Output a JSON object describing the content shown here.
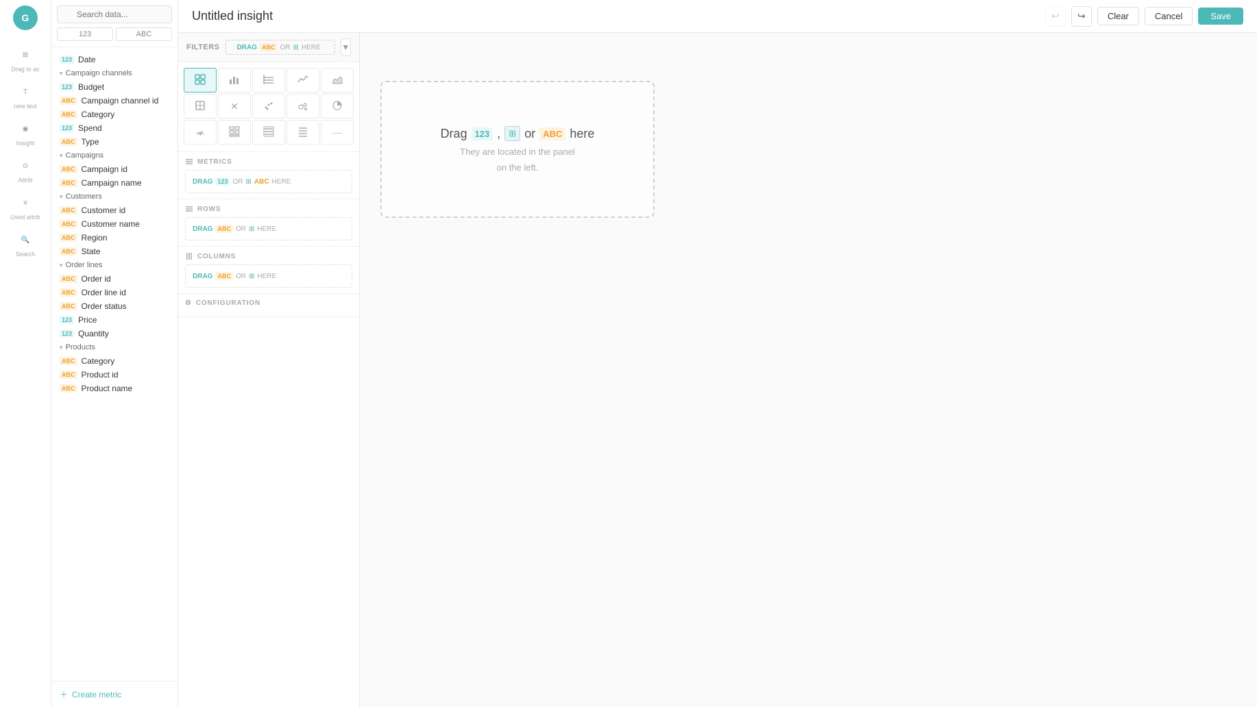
{
  "app": {
    "logo_text": "G",
    "nav_items": [
      {
        "id": "drag",
        "label": "Drag to ac",
        "icon": "⊞"
      },
      {
        "id": "new_text",
        "label": "new text",
        "icon": "T"
      },
      {
        "id": "insight",
        "label": "Insight",
        "icon": "◉"
      },
      {
        "id": "attrib",
        "label": "Attrib",
        "icon": "⊙"
      },
      {
        "id": "used_attrib",
        "label": "Used attrib",
        "icon": "≡"
      },
      {
        "id": "search",
        "label": "Search",
        "icon": "🔍"
      }
    ]
  },
  "data_panel": {
    "search_placeholder": "Search data...",
    "type_tabs": [
      {
        "id": "numeric",
        "label": "123",
        "active": false
      },
      {
        "id": "text",
        "label": "ABC",
        "active": false
      }
    ],
    "sections": [
      {
        "id": "date",
        "label": "Date",
        "type": "123",
        "is_section": false
      },
      {
        "id": "campaign_channels",
        "label": "Campaign channels",
        "expanded": true,
        "items": [
          {
            "id": "budget",
            "label": "Budget",
            "type": "123"
          },
          {
            "id": "campaign_channel_id",
            "label": "Campaign channel id",
            "type": "ABC"
          },
          {
            "id": "category_cc",
            "label": "Category",
            "type": "ABC"
          },
          {
            "id": "spend",
            "label": "Spend",
            "type": "123"
          },
          {
            "id": "type_cc",
            "label": "Type",
            "type": "ABC"
          }
        ]
      },
      {
        "id": "campaigns",
        "label": "Campaigns",
        "expanded": true,
        "items": [
          {
            "id": "campaign_id",
            "label": "Campaign id",
            "type": "ABC"
          },
          {
            "id": "campaign_name",
            "label": "Campaign name",
            "type": "ABC"
          }
        ]
      },
      {
        "id": "customers",
        "label": "Customers",
        "expanded": true,
        "items": [
          {
            "id": "customer_id",
            "label": "Customer id",
            "type": "ABC"
          },
          {
            "id": "customer_name",
            "label": "Customer name",
            "type": "ABC"
          },
          {
            "id": "region",
            "label": "Region",
            "type": "ABC"
          },
          {
            "id": "state",
            "label": "State",
            "type": "ABC"
          }
        ]
      },
      {
        "id": "order_lines",
        "label": "Order lines",
        "expanded": true,
        "items": [
          {
            "id": "order_id",
            "label": "Order id",
            "type": "ABC"
          },
          {
            "id": "order_line_id",
            "label": "Order line id",
            "type": "ABC"
          },
          {
            "id": "order_status",
            "label": "Order status",
            "type": "ABC"
          },
          {
            "id": "price",
            "label": "Price",
            "type": "123"
          },
          {
            "id": "quantity",
            "label": "Quantity",
            "type": "123"
          }
        ]
      },
      {
        "id": "products",
        "label": "Products",
        "expanded": true,
        "items": [
          {
            "id": "category_p",
            "label": "Category",
            "type": "ABC"
          },
          {
            "id": "product_id",
            "label": "Product id",
            "type": "ABC"
          },
          {
            "id": "product_name",
            "label": "Product name",
            "type": "ABC"
          }
        ]
      }
    ],
    "create_metric_label": "Create metric"
  },
  "top_bar": {
    "title": "Untitled insight",
    "undo_label": "undo",
    "redo_label": "redo",
    "clear_label": "Clear",
    "cancel_label": "Cancel",
    "save_label": "Save"
  },
  "chart_types": [
    [
      {
        "id": "table",
        "icon": "⊞",
        "active": true
      },
      {
        "id": "bar",
        "icon": "▦",
        "active": false
      },
      {
        "id": "pivot",
        "icon": "⊟",
        "active": false
      },
      {
        "id": "line",
        "icon": "∿",
        "active": false
      },
      {
        "id": "area",
        "icon": "⛰",
        "active": false
      }
    ],
    [
      {
        "id": "geo",
        "icon": "◲",
        "active": false
      },
      {
        "id": "cross",
        "icon": "✕",
        "active": false
      },
      {
        "id": "scatter",
        "icon": "⁙",
        "active": false
      },
      {
        "id": "bubble",
        "icon": "⁚",
        "active": false
      },
      {
        "id": "pie",
        "icon": "◕",
        "active": false
      }
    ],
    [
      {
        "id": "gauge",
        "icon": "◎",
        "active": false
      },
      {
        "id": "grid1",
        "icon": "⊞",
        "active": false
      },
      {
        "id": "list1",
        "icon": "≡",
        "active": false
      },
      {
        "id": "list2",
        "icon": "☰",
        "active": false
      },
      {
        "id": "empty",
        "icon": "",
        "active": false
      }
    ]
  ],
  "filters": {
    "label": "FILTERS",
    "drop_zone_text": "DRAG",
    "drop_zone_or": "OR",
    "drop_zone_here": "HERE"
  },
  "config_sections": [
    {
      "id": "metrics",
      "label": "METRICS",
      "drop_zone_text": "DRAG",
      "drop_zone_or": "OR",
      "drop_zone_here": "HERE"
    },
    {
      "id": "rows",
      "label": "ROWS",
      "drop_zone_text": "DRAG",
      "drop_zone_or": "OR",
      "drop_zone_here": "HERE"
    },
    {
      "id": "columns",
      "label": "COLUMNS",
      "drop_zone_text": "DRAG",
      "drop_zone_or": "OR",
      "drop_zone_here": "HERE"
    },
    {
      "id": "configuration",
      "label": "CONFIGURATION",
      "icon": "⚙"
    }
  ],
  "canvas": {
    "empty_title_pre": "Drag",
    "empty_badge_123": "123",
    "empty_badge_comma": ",",
    "empty_badge_table": "⊞",
    "empty_or": "or",
    "empty_badge_abc": "ABC",
    "empty_title_post": "here",
    "empty_sub1": "They are located in the panel",
    "empty_sub2": "on the left."
  }
}
